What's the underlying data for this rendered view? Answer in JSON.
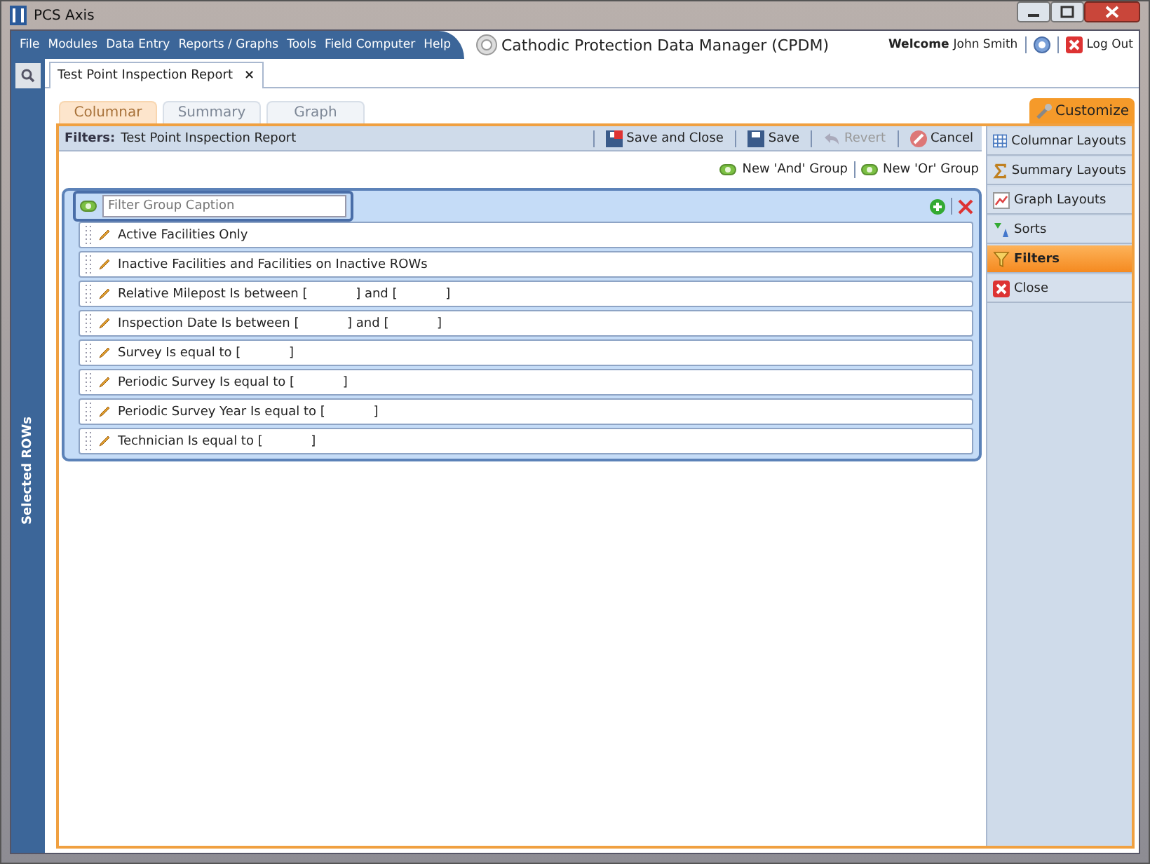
{
  "window": {
    "title": "PCS Axis"
  },
  "menu": [
    "File",
    "Modules",
    "Data Entry",
    "Reports / Graphs",
    "Tools",
    "Field Computer",
    "Help"
  ],
  "app_title": "Cathodic Protection Data Manager (CPDM)",
  "user": {
    "welcome": "Welcome",
    "name": "John Smith",
    "logout": "Log Out"
  },
  "sidebar": {
    "label": "Selected ROWs"
  },
  "doc_tab": {
    "label": "Test Point Inspection Report",
    "close": "×"
  },
  "view_tabs": [
    {
      "label": "Columnar",
      "selected": true
    },
    {
      "label": "Summary",
      "selected": false
    },
    {
      "label": "Graph",
      "selected": false
    }
  ],
  "customize": "Customize",
  "filters_bar": {
    "label": "Filters:",
    "report": "Test Point Inspection Report",
    "actions": [
      {
        "label": "Save and Close",
        "kind": "saveclose",
        "disabled": false
      },
      {
        "label": "Save",
        "kind": "save",
        "disabled": false
      },
      {
        "label": "Revert",
        "kind": "revert",
        "disabled": true
      },
      {
        "label": "Cancel",
        "kind": "cancel",
        "disabled": false
      }
    ]
  },
  "group_links": [
    "New 'And' Group",
    "New 'Or' Group"
  ],
  "filter_group": {
    "placeholder": "Filter Group Caption",
    "conditions": [
      {
        "text": "Active Facilities Only"
      },
      {
        "text": "Inactive Facilities and Facilities on Inactive ROWs"
      },
      {
        "text": "Relative Milepost Is between [            ] and [            ]"
      },
      {
        "text": "Inspection Date Is between [            ] and [            ]"
      },
      {
        "text": "Survey Is equal to [            ]"
      },
      {
        "text": "Periodic Survey Is equal to [            ]"
      },
      {
        "text": "Periodic Survey Year Is equal to [            ]"
      },
      {
        "text": "Technician Is equal to [            ]"
      }
    ]
  },
  "side_panel": [
    {
      "label": "Columnar Layouts",
      "kind": "columnar",
      "selected": false
    },
    {
      "label": "Summary Layouts",
      "kind": "summary",
      "selected": false
    },
    {
      "label": "Graph Layouts",
      "kind": "graph",
      "selected": false
    },
    {
      "label": "Sorts",
      "kind": "sorts",
      "selected": false
    },
    {
      "label": "Filters",
      "kind": "filters",
      "selected": true
    },
    {
      "label": "Close",
      "kind": "close",
      "selected": false
    }
  ]
}
